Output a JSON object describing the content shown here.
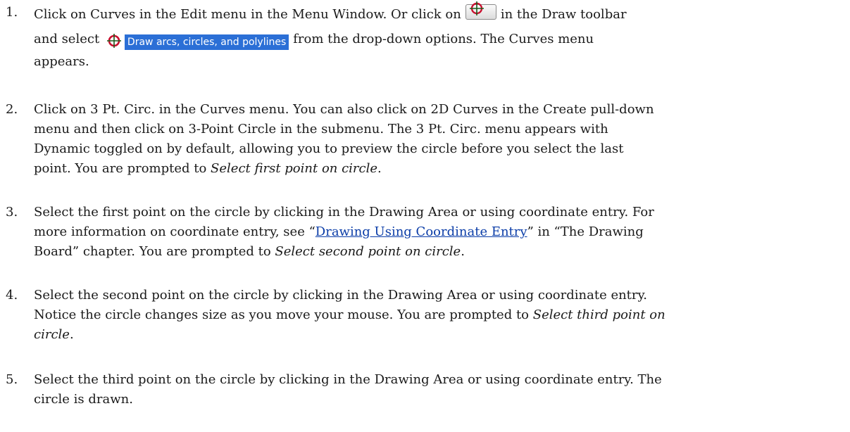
{
  "steps": [
    {
      "number": "1.",
      "line1_a": "Click on Curves in the Edit menu in the Menu Window. Or click on",
      "line1_b": "in the Draw toolbar",
      "line2_a": "and select",
      "option_label": "Draw arcs, circles, and polylines",
      "line2_b": "from the drop-down options. The Curves menu",
      "line3": "appears.",
      "toolbar_icon": "circle-crosshair-icon",
      "option_icon": "circle-crosshair-icon"
    },
    {
      "number": "2.",
      "line1": "Click on 3 Pt. Circ. in the Curves menu. You can also click on 2D Curves in the Create pull-down",
      "line2": "menu and then click on 3-Point Circle in the submenu. The 3 Pt. Circ. menu appears with",
      "line3": "Dynamic toggled on by default, allowing you to preview the circle before you select the last",
      "line4_a": "point. You are prompted to ",
      "line4_em": "Select first point on circle",
      "line4_b": "."
    },
    {
      "number": "3.",
      "line1": "Select the first point on the circle by clicking in the Drawing Area or using coordinate entry. For",
      "line2_a": "more information on coordinate entry, see “",
      "link_text": "Drawing Using Coordinate Entry",
      "line2_b": "” in “The Drawing",
      "line3_a": "Board” chapter. You are prompted to ",
      "line3_em": "Select second point on circle",
      "line3_b": "."
    },
    {
      "number": "4.",
      "line1": "Select the second point on the circle by clicking in the Drawing Area or using coordinate entry.",
      "line2_a": "Notice the circle changes size as you move your mouse. You are prompted to ",
      "line2_em": "Select third point on",
      "line3_em": "circle",
      "line3_b": "."
    },
    {
      "number": "5.",
      "line1": "Select the third point on the circle by clicking in the Drawing Area or using coordinate entry. The",
      "line2": "circle is drawn."
    }
  ],
  "colors": {
    "link": "#0b3da8",
    "highlight": "#2b6fd6",
    "icon_red": "#c8102e"
  }
}
